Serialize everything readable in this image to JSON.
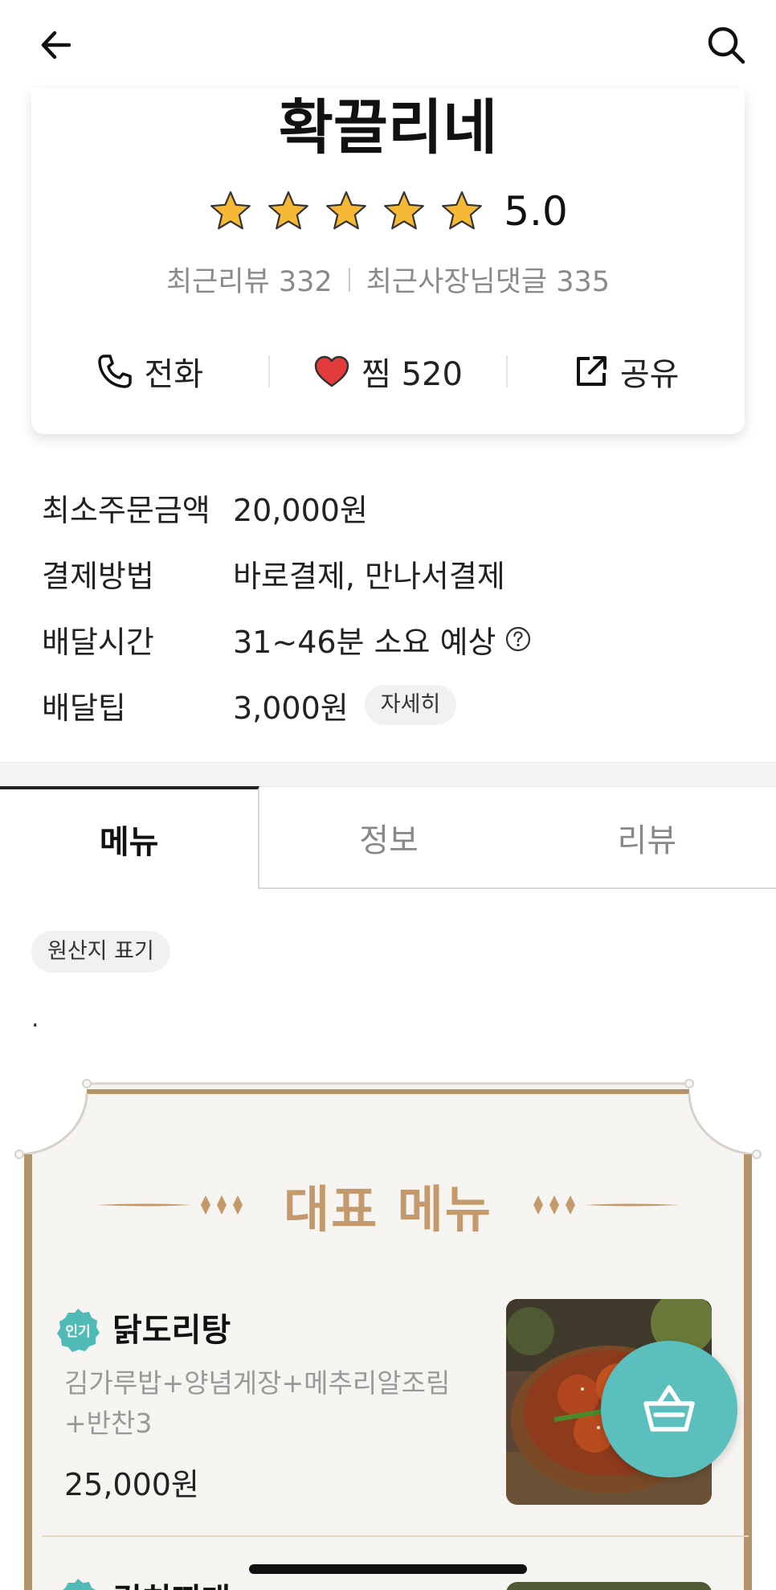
{
  "header": {
    "back_icon": "arrow-left-icon",
    "search_icon": "search-icon"
  },
  "store": {
    "name": "확끌리네",
    "rating": "5.0",
    "star_count": 5,
    "recent_reviews_label": "최근리뷰 332",
    "recent_owner_replies_label": "최근사장님댓글 335",
    "actions": {
      "call": "전화",
      "favorite": "찜 520",
      "share": "공유"
    }
  },
  "info": [
    {
      "label": "최소주문금액",
      "value": "20,000원"
    },
    {
      "label": "결제방법",
      "value": "바로결제, 만나서결제"
    },
    {
      "label": "배달시간",
      "value": "31~46분 소요 예상"
    },
    {
      "label": "배달팁",
      "value": "3,000원",
      "chip": "자세히"
    }
  ],
  "tabs": [
    {
      "label": "메뉴",
      "active": true
    },
    {
      "label": "정보",
      "active": false
    },
    {
      "label": "리뷰",
      "active": false
    }
  ],
  "origin_chip": "원산지 표기",
  "dot_text": ".",
  "featured": {
    "title": "대표 메뉴",
    "items": [
      {
        "badge": "인기",
        "name": "닭도리탕",
        "desc": "김가루밥+양념게장+메추리알조림+반찬3",
        "price": "25,000원"
      },
      {
        "badge": "인기",
        "name": "김치찌개"
      }
    ]
  },
  "colors": {
    "accent_teal": "#5bc0bd",
    "gold": "#c49a6c",
    "star": "#f5b935",
    "heart": "#e23b3b"
  }
}
